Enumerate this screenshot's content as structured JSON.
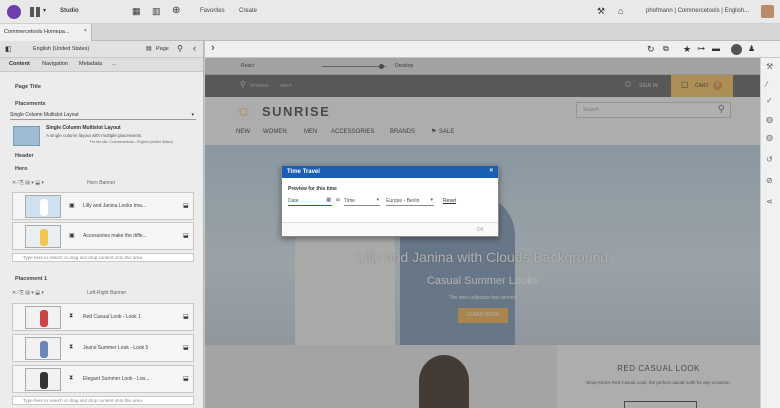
{
  "topbar": {
    "app_name": "Studio",
    "favorites": "Favorites",
    "create": "Create",
    "user": "phofmann | Commercetools | English..."
  },
  "tabbar": {
    "tab_label": "Commercetools Homepa..."
  },
  "left": {
    "locale": "English (United States)",
    "page_label": "Page",
    "subtabs": [
      "Content",
      "Navigation",
      "Metadata",
      "..."
    ],
    "page_title_label": "Page Title",
    "placements_label": "Placements",
    "layout_select": "Single Column Multislot Layout",
    "layout_title": "Single Column Multislot Layout",
    "layout_desc": "A single column layout with multiple placements.",
    "layout_site": "For the site: Commercetools - English (United States)",
    "header_label": "Header",
    "hero_label": "Hero",
    "hero_type": "Hero Banner",
    "hero_items": [
      "Lilly and Janina Looks Ima...",
      "Accessories make the diffe..."
    ],
    "dropzone_text": "Type here to search or drag and drop content onto this area.",
    "placement1_label": "Placement 1",
    "placement1_type": "Left-Right Banner",
    "placement1_items": [
      "Red Casual Look - Look 1",
      "Jeans Summer Look - Look 5",
      "Elegant Summer Look - Loo..."
    ],
    "dropzone_text2": "Type here to search or drag and drop content onto this area."
  },
  "preview": {
    "channel": "React",
    "device": "Desktop",
    "stores": "STORES",
    "help": "HELP",
    "sign_in": "SIGN IN",
    "cart": "CART",
    "cart_count": "0",
    "brand": "SUNRISE",
    "search_placeholder": "Search",
    "nav": [
      "NEW",
      "WOMEN",
      "MEN",
      "ACCESSORIES",
      "BRANDS",
      "SALE"
    ],
    "hero_title": "Lilly and Janina with Clouds Background",
    "hero_subtitle": "Casual Summer Looks",
    "hero_small": "The new collection has arrived",
    "hero_button": "LEARN MORE",
    "promo_title": "RED CASUAL LOOK",
    "promo_text": "Shop Kara's Red Casual Look, the perfect casual outfit for any occasion."
  },
  "dialog": {
    "title": "Time Travel",
    "preview_label": "Preview for this time",
    "date_placeholder": "Date",
    "at": "at",
    "time_placeholder": "Time",
    "timezone": "Europe - Berlin",
    "reset": "Reset",
    "ok": "OK"
  },
  "colors": {
    "accent": "#1a5fb4",
    "cart": "#f6c35b",
    "hero_button": "#f4b14b"
  }
}
